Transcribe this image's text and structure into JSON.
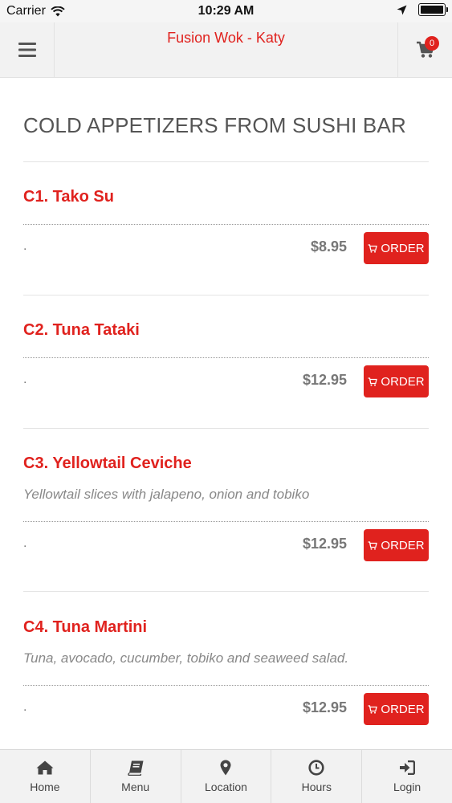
{
  "status_bar": {
    "carrier": "Carrier",
    "time": "10:29 AM"
  },
  "header": {
    "title": "Fusion Wok - Katy",
    "cart_count": "0"
  },
  "section": {
    "title": "COLD APPETIZERS FROM SUSHI BAR"
  },
  "items": [
    {
      "name": "C1. Tako Su",
      "description": "",
      "note": ".",
      "price": "$8.95",
      "order_label": "ORDER"
    },
    {
      "name": "C2. Tuna Tataki",
      "description": "",
      "note": ".",
      "price": "$12.95",
      "order_label": "ORDER"
    },
    {
      "name": "C3. Yellowtail Ceviche",
      "description": "Yellowtail slices with jalapeno, onion and tobiko",
      "note": ".",
      "price": "$12.95",
      "order_label": "ORDER"
    },
    {
      "name": "C4. Tuna Martini",
      "description": "Tuna, avocado, cucumber, tobiko and seaweed salad.",
      "note": ".",
      "price": "$12.95",
      "order_label": "ORDER"
    }
  ],
  "bottom_nav": [
    {
      "label": "Home",
      "icon": "home-icon"
    },
    {
      "label": "Menu",
      "icon": "book-icon"
    },
    {
      "label": "Location",
      "icon": "map-pin-icon"
    },
    {
      "label": "Hours",
      "icon": "clock-icon"
    },
    {
      "label": "Login",
      "icon": "sign-in-icon"
    }
  ],
  "colors": {
    "accent": "#e0221e",
    "header_bg": "#f2f2f2",
    "text": "#555555"
  }
}
